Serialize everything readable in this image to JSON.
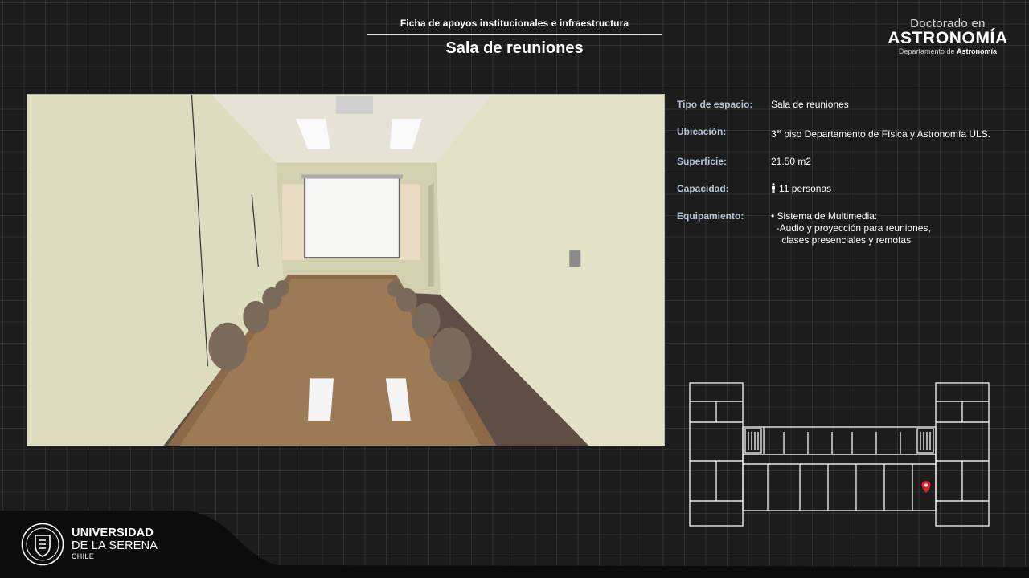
{
  "header": {
    "subtitle": "Ficha de apoyos institucionales e infraestructura",
    "title": "Sala de reuniones"
  },
  "brand": {
    "line1": "Doctorado en",
    "line2": "ASTRONOMÍA",
    "line3_prefix": "Departamento de ",
    "line3_bold": "Astronomía"
  },
  "info": {
    "tipo": {
      "label": "Tipo de espacio:",
      "value": "Sala de reuniones"
    },
    "ubicacion": {
      "label": "Ubicación:",
      "floor_num": "3",
      "floor_sup": "er",
      "value_rest": " piso Departamento de Física y Astronomía ULS."
    },
    "superficie": {
      "label": "Superficie:",
      "value": "21.50 m2"
    },
    "capacidad": {
      "label": "Capacidad:",
      "value": "11 personas",
      "icon": "person-icon"
    },
    "equipamiento": {
      "label": "Equipamiento:",
      "lines": [
        "• Sistema de Multimedia:",
        "  -Audio y proyección para reuniones,",
        "    clases presenciales y remotas"
      ]
    }
  },
  "university": {
    "line1": "UNIVERSIDAD",
    "line2": "DE LA SERENA",
    "line3": "CHILE",
    "seal_icon": "university-seal-icon"
  },
  "colors": {
    "background": "#1c1c1c",
    "label": "#b4c4dc",
    "marker": "#e0202a"
  }
}
